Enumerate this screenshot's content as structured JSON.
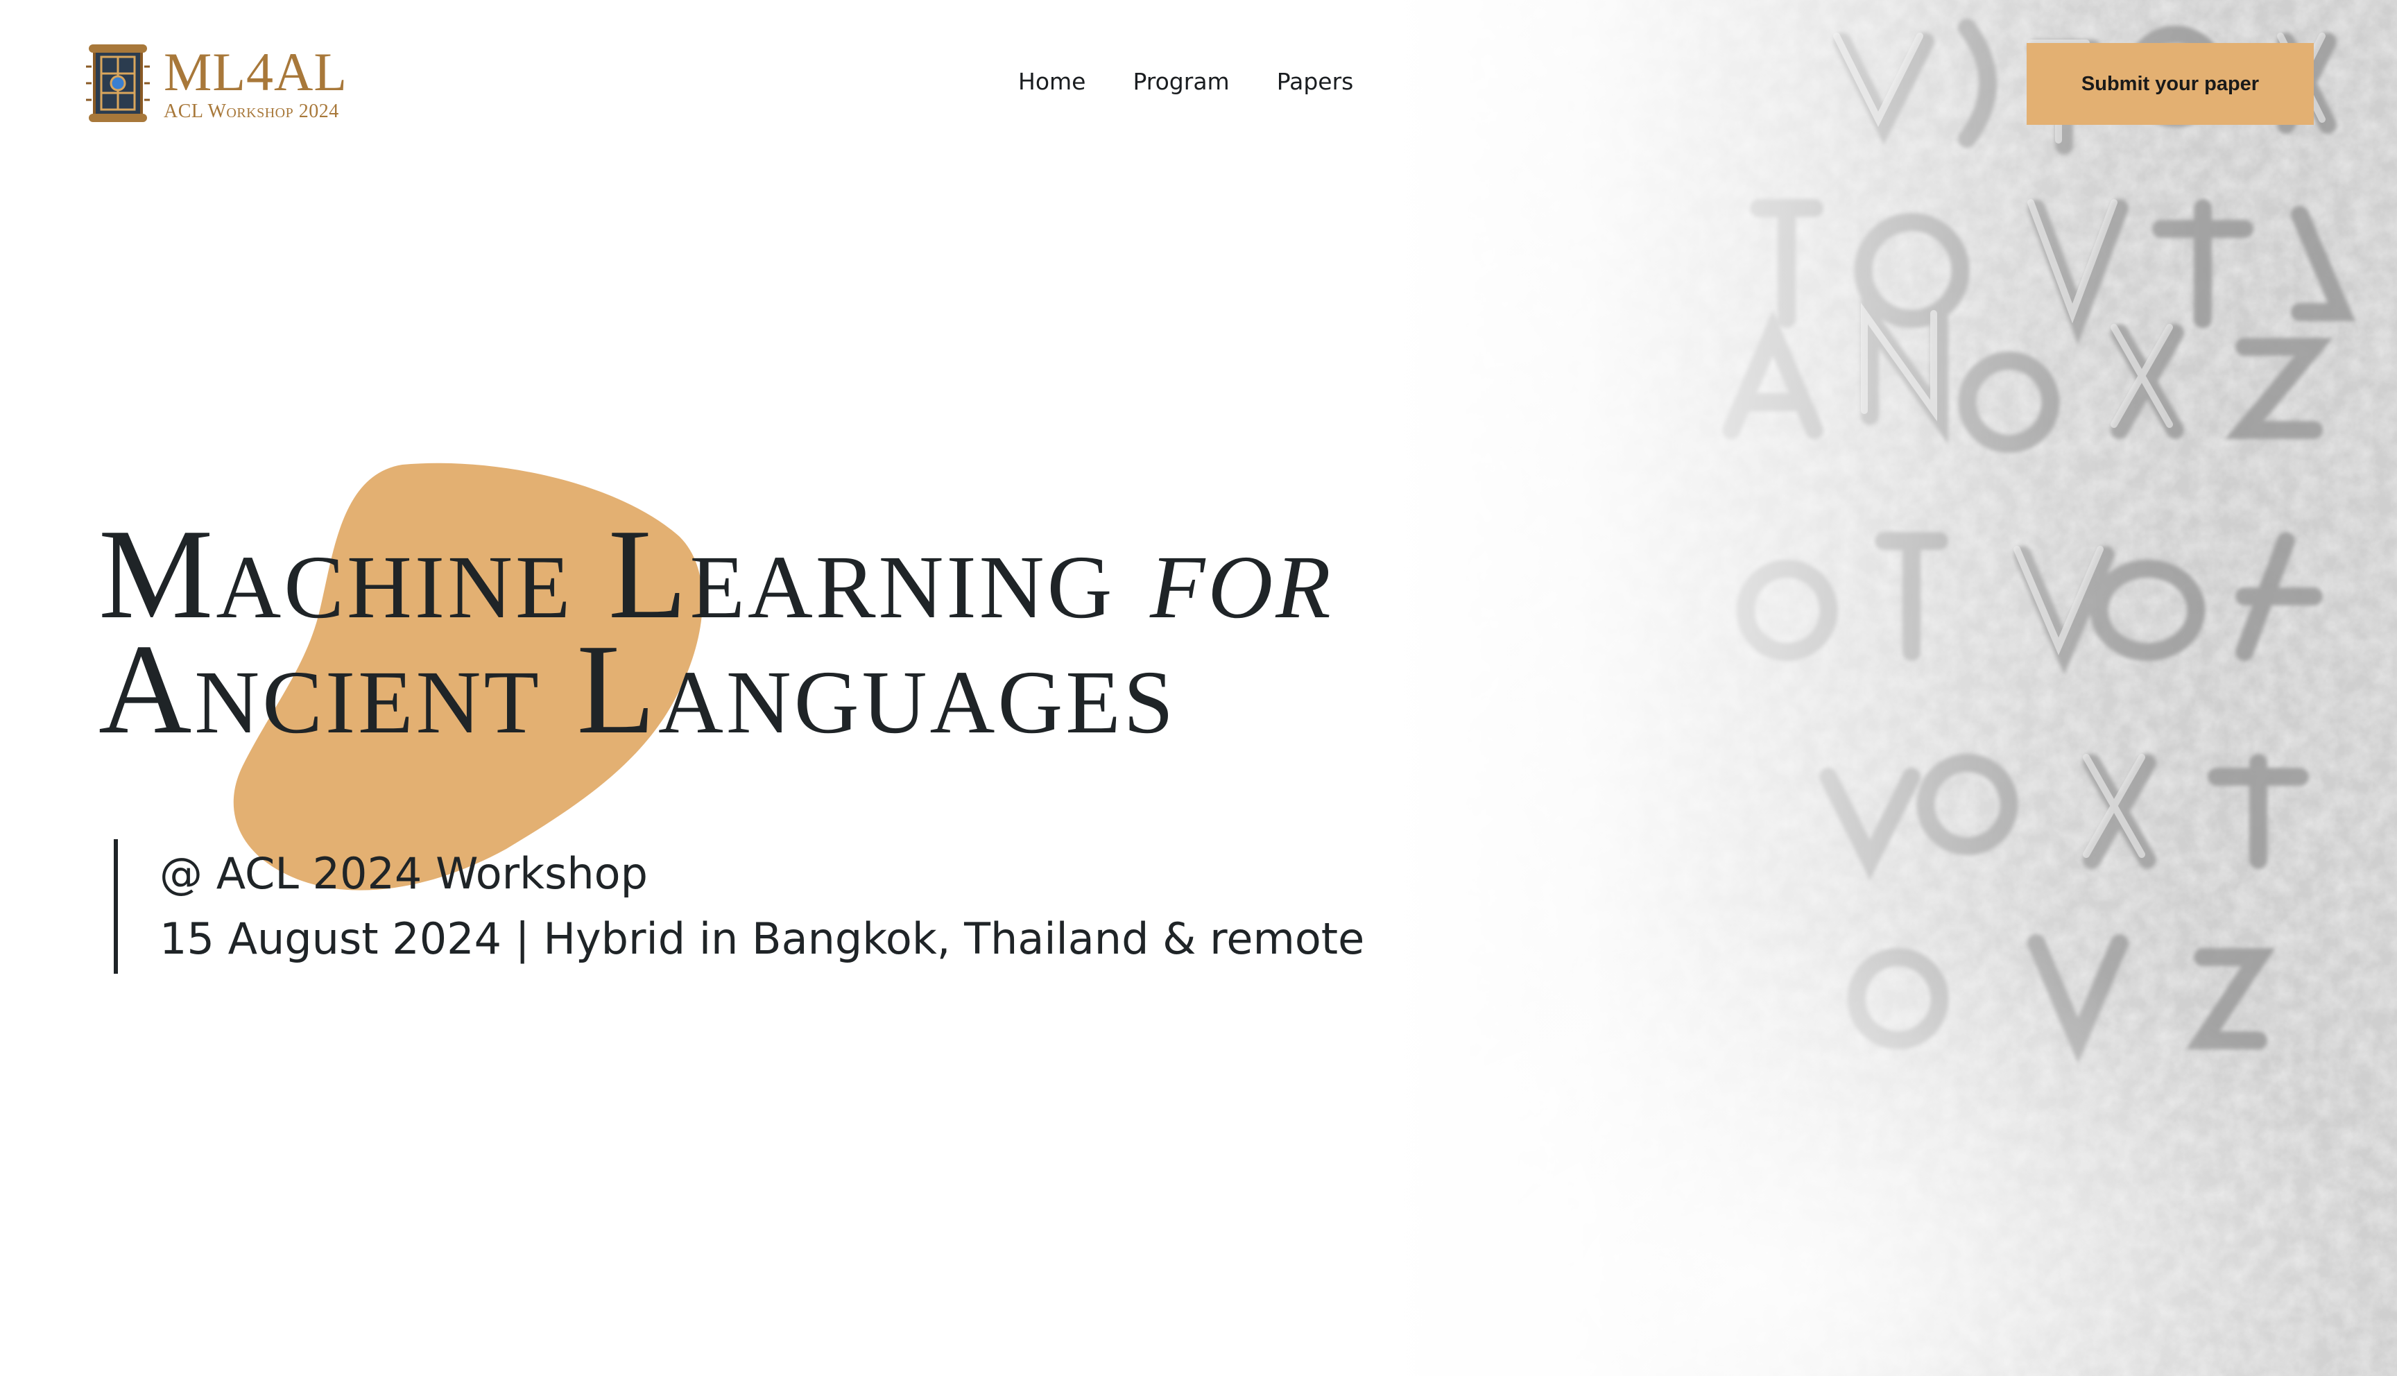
{
  "header": {
    "logo_title": "ML4AL",
    "logo_subtitle": "ACL Workshop 2024",
    "nav": [
      {
        "label": "Home"
      },
      {
        "label": "Program"
      },
      {
        "label": "Papers"
      }
    ],
    "cta_label": "Submit your paper"
  },
  "hero": {
    "title_part1": "Machine Learning",
    "title_for": "for",
    "title_line2": "Ancient Languages",
    "event_line": "@ ACL 2024 Workshop",
    "date_location_line": "15 August 2024 | Hybrid in Bangkok, Thailand & remote"
  },
  "colors": {
    "accent": "#e3b072",
    "logo": "#a8783a",
    "text": "#1f2427",
    "background": "#ffffff"
  }
}
